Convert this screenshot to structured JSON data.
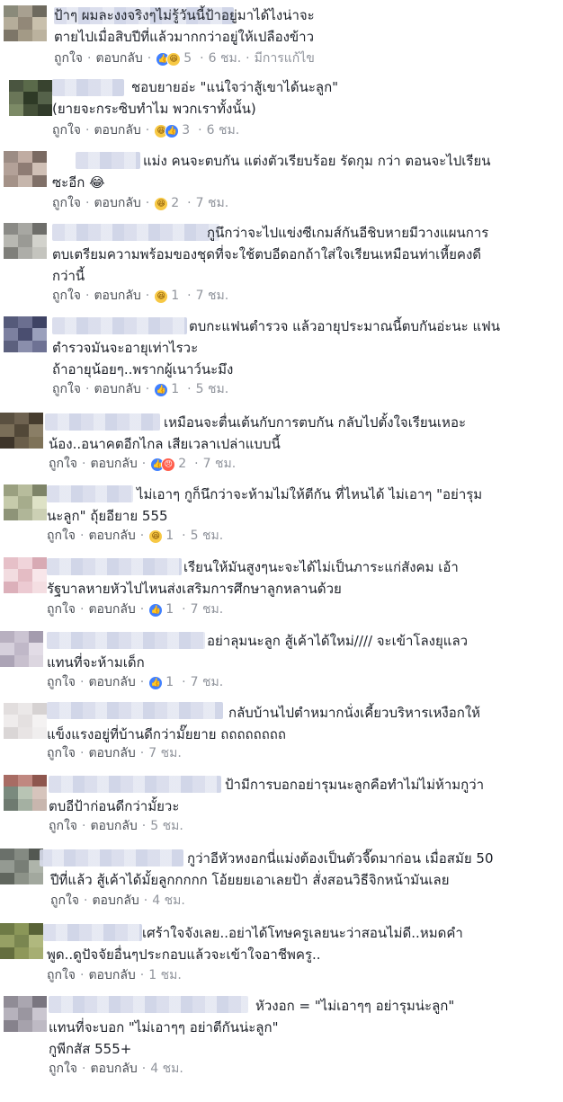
{
  "ui": {
    "like_label": "ถูกใจ",
    "reply_label": "ตอบกลับ",
    "dot": "·",
    "edited_label": "มีการแก้ไข"
  },
  "reaction_icons": {
    "like": "thumbs-up-icon",
    "haha": "laughing-face-icon",
    "angry": "angry-face-icon"
  },
  "colors": {
    "link": "#4b4f56",
    "meta": "#90949c",
    "like_blue": "#4080ff",
    "haha_yellow": "#f7c844",
    "angry_red": "#ff5d4b"
  },
  "comments": [
    {
      "lines": [
        "ป้าๆ ผมละงงจริงๆไม่รู้วันนี้ป้าอยู่มาได้ไงน่าจะ",
        "ตายไปเมื่อสิบปีที่แล้วมากกว่าอยู่ให้เปลืองข้าว"
      ],
      "reaction_count": "5",
      "time": "6 ชม.",
      "edited": true
    },
    {
      "lines": [
        "ชอบยายอ่ะ \"แน่ใจว่าสู้เขาได้นะลูก\"",
        "(ยายจะกระซิบทำไม พวกเราทั้งนั้น)"
      ],
      "reaction_count": "3",
      "time": "6 ชม."
    },
    {
      "lines": [
        "แม่ง คนจะตบกัน แต่งตัวเรียบร้อย รัดกุม กว่า ตอนจะไปเรียน",
        "ซะอีก 😂"
      ],
      "reaction_count": "2",
      "time": "7 ชม."
    },
    {
      "lines": [
        "กูนึกว่าจะไปแข่งซีเกมส์กันอีชิบหายมีวางแผนการ",
        "ตบเตรียมความพร้อมของชุดที่จะใช้ตบอีดอกถ้าใส่ใจเรียนเหมือนท่าเหี้ยคงดี",
        "กว่านี้"
      ],
      "reaction_count": "1",
      "time": "7 ชม."
    },
    {
      "lines": [
        "ตบกะแฟนตำรวจ แล้วอายุประมาณนี้ตบกันอ่ะนะ แฟน",
        "ตำรวจมันจะอายุเท่าไรวะ",
        "ถ้าอายุน้อยๆ..พรากผู้เนาว์นะมึง"
      ],
      "reaction_count": "1",
      "time": "5 ชม."
    },
    {
      "lines": [
        "เหมือนจะตื่นเต้นกับการตบกัน กลับไปตั้งใจเรียนเหอะ",
        "น้อง..อนาคตอีกไกล เสียเวลาเปล่าแบบนี้"
      ],
      "reaction_count": "2",
      "time": "7 ชม."
    },
    {
      "lines": [
        "ไม่เอาๆ กูก็นึกว่าจะห้ามไม่ให้ตีกัน ที่ไหนได้ ไม่เอาๆ \"อย่ารุม",
        "นะลูก\" ถุ้ยอียาย 555"
      ],
      "reaction_count": "1",
      "time": "5 ชม."
    },
    {
      "lines": [
        "เรียนให้มันสูงๆนะจะได้ไม่เป็นภาระแก่สังคม เอ้า",
        "รัฐบาลหายหัวไปไหนส่งเสริมการศึกษาลูกหลานด้วย"
      ],
      "reaction_count": "1",
      "time": "7 ชม."
    },
    {
      "lines": [
        "อย่าลุมนะลูก สู้เค้าได้ใหม่//// จะเข้าโลงยุแลว",
        "แทนที่จะห้ามเด็ก"
      ],
      "reaction_count": "1",
      "time": "7 ชม."
    },
    {
      "lines": [
        "กลับบ้านไปตำหมากนั่งเคี้ยวบริหารเหงือกให้",
        "แข็งแรงอยู่ที่บ้านดีกว่ามั๊ยยาย ถถถถถถถถ"
      ],
      "time": "7 ชม."
    },
    {
      "lines": [
        "ป้ามีการบอกอย่ารุมนะลูกคือทำไม่ไม่ห้ามกูว่า",
        "ตบอีป้าก่อนดีกว่ามั้ยวะ"
      ],
      "time": "5 ชม."
    },
    {
      "lines": [
        "กูว่าอีหัวหงอกนี่แม่งต้องเป็นตัวจี๊ดมาก่อน เมื่อสมัย 50",
        "ปีที่แล้ว สู้เค้าได้มั้ยลูกกกกก โอ้ยยยเอาเลยป้า สั่งสอนวิธีจิกหน้ามันเลย"
      ],
      "time": "4 ชม."
    },
    {
      "lines": [
        "เศร้าใจจังเลย..อย่าได้โทษครูเลยนะว่าสอนไม่ดี..หมดคำ",
        "พูด..ดูปัจจัยอื่นๆประกอบแล้วจะเข้าใจอาชีพครู.."
      ],
      "time": "1 ชม."
    },
    {
      "lines": [
        "หัวงอก = \"ไม่เอาๆๆ อย่ารุมน่ะลูก\"",
        "แทนที่จะบอก \"ไม่เอาๆๆ อย่าตีกันน่ะลูก\"",
        "กูพีกสัส 555+"
      ],
      "time": "4 ชม."
    }
  ]
}
